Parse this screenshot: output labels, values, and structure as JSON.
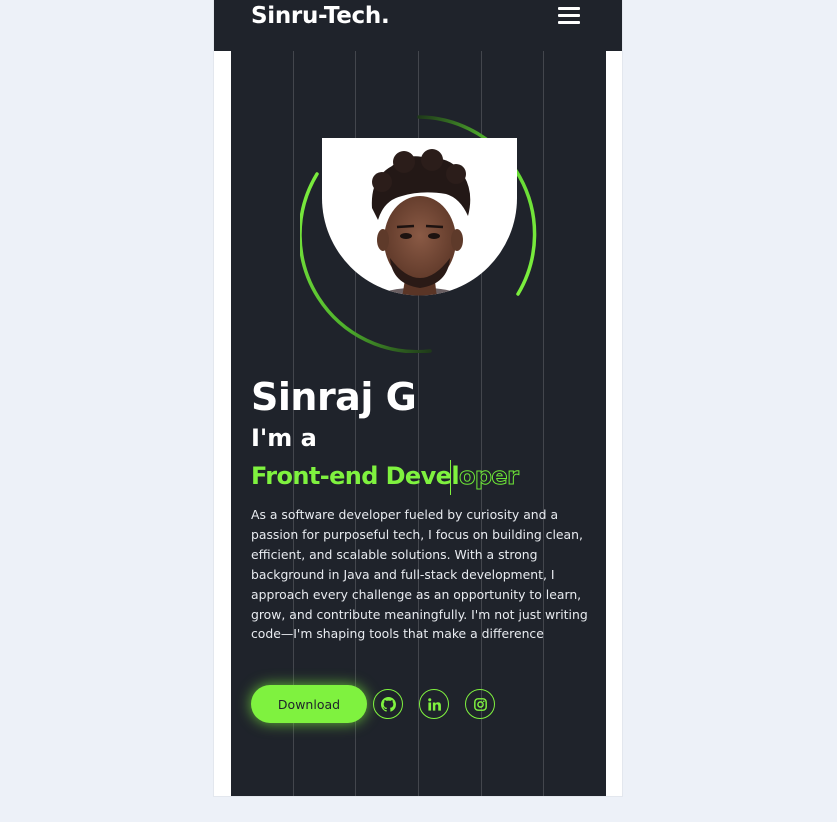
{
  "navbar": {
    "brand": "Sinru-Tech.",
    "menu_icon": "hamburger-menu-icon"
  },
  "hero": {
    "name": "Sinraj G",
    "greeting": "I'm a",
    "role_typed": "Front-end Devel",
    "role_remaining": "oper",
    "bio": "As a software developer fueled by curiosity and a passion for purposeful tech, I focus on building clean, efficient, and scalable solutions. With a strong background in Java and full-stack development, I approach every challenge as an opportunity to learn, grow, and contribute meaningfully. I'm not just writing code—I'm shaping tools that make a difference",
    "download_label": "Download",
    "social_icons": [
      "github-icon",
      "linkedin-icon",
      "instagram-icon"
    ]
  },
  "colors": {
    "accent": "#7ff23f",
    "hero_background": "#1f232b",
    "page_background": "#edf1f8"
  }
}
